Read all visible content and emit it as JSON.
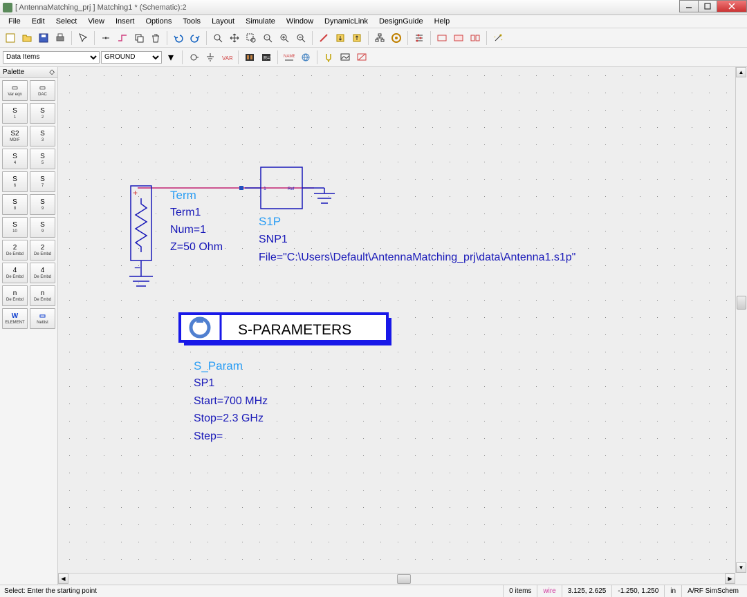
{
  "window": {
    "title": "[ AntennaMatching_prj ] Matching1 * (Schematic):2"
  },
  "menu": [
    "File",
    "Edit",
    "Select",
    "View",
    "Insert",
    "Options",
    "Tools",
    "Layout",
    "Simulate",
    "Window",
    "DynamicLink",
    "DesignGuide",
    "Help"
  ],
  "combos": {
    "category": "Data Items",
    "item": "GROUND"
  },
  "palette": {
    "title": "Palette",
    "items": [
      {
        "glyph": "▭",
        "label": "Var eqn"
      },
      {
        "glyph": "▭",
        "label": "DAC"
      },
      {
        "glyph": "S",
        "label": "1"
      },
      {
        "glyph": "S",
        "label": "2"
      },
      {
        "glyph": "S2",
        "label": "MDIF"
      },
      {
        "glyph": "S",
        "label": "3"
      },
      {
        "glyph": "S",
        "label": "4"
      },
      {
        "glyph": "S",
        "label": "5"
      },
      {
        "glyph": "S",
        "label": "6"
      },
      {
        "glyph": "S",
        "label": "7"
      },
      {
        "glyph": "S",
        "label": "8"
      },
      {
        "glyph": "S",
        "label": "9"
      },
      {
        "glyph": "S",
        "label": "10"
      },
      {
        "glyph": "S",
        "label": "9"
      },
      {
        "glyph": "2",
        "label": "De Embd"
      },
      {
        "glyph": "2",
        "label": "De Embd"
      },
      {
        "glyph": "4",
        "label": "De Embd"
      },
      {
        "glyph": "4",
        "label": "De Embd"
      },
      {
        "glyph": "n",
        "label": "De Embd"
      },
      {
        "glyph": "n",
        "label": "De Embd"
      },
      {
        "glyph": "W",
        "label": "ELEMENT"
      },
      {
        "glyph": "▭",
        "label": "Netlist"
      }
    ]
  },
  "schematic": {
    "term": {
      "type": "Term",
      "name": "Term1",
      "num": "Num=1",
      "z": "Z=50 Ohm",
      "ref": "Ref"
    },
    "snp": {
      "type": "S1P",
      "name": "SNP1",
      "file": "File=\"C:\\Users\\Default\\AntennaMatching_prj\\data\\Antenna1.s1p\""
    },
    "sp": {
      "block_title": "S-PARAMETERS",
      "type": "S_Param",
      "name": "SP1",
      "start": "Start=700 MHz",
      "stop": "Stop=2.3 GHz",
      "step": "Step="
    }
  },
  "status": {
    "hint": "Select: Enter the starting point",
    "items": "0 items",
    "mode": "wire",
    "coord1": "3.125, 2.625",
    "coord2": "-1.250, 1.250",
    "units": "in",
    "sim": "A/RF  SimSchem"
  }
}
